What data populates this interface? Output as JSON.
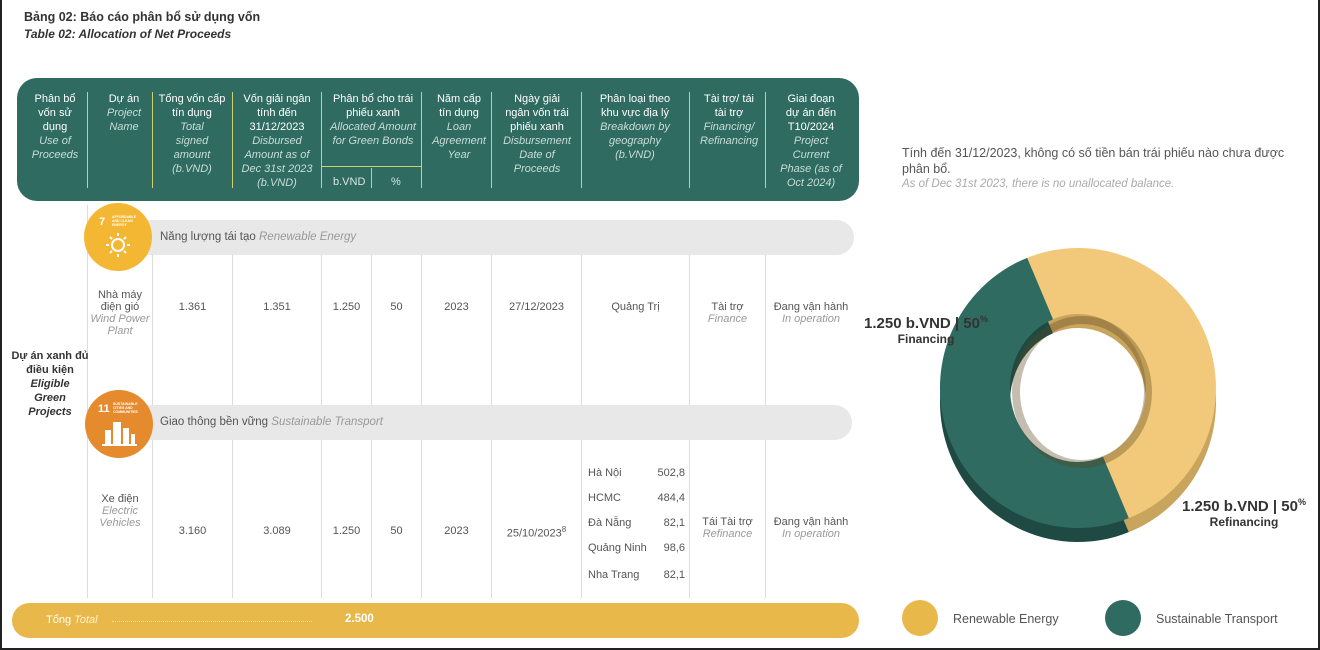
{
  "title": {
    "vi": "Bảng 02: Báo cáo phân bổ sử dụng vốn",
    "en": "Table 02: Allocation of Net Proceeds"
  },
  "header": {
    "use": {
      "vi": "Phân bổ vốn sử dụng",
      "en": "Use of Proceeds"
    },
    "project": {
      "vi": "Dự án",
      "en": "Project Name"
    },
    "total_signed": {
      "vi": "Tổng vốn cấp tín dụng",
      "en": "Total signed amount (b.VND)"
    },
    "disbursed": {
      "vi": "Vốn giải ngân tính đến 31/12/2023",
      "en": "Disbursed Amount as of Dec 31st 2023 (b.VND)"
    },
    "allocated": {
      "vi": "Phân bổ cho trái phiếu xanh",
      "en": "Allocated Amount for Green Bonds",
      "sub1": "b.VND",
      "sub2": "%"
    },
    "loan_year": {
      "vi": "Năm cấp tín dụng",
      "en": "Loan Agreement Year"
    },
    "disb_date": {
      "vi": "Ngày giải ngân vốn trái phiếu xanh",
      "en": "Disbursement Date of Proceeds"
    },
    "geography": {
      "vi": "Phân loại theo khu vực địa lý",
      "en": "Breakdown by geography (b.VND)"
    },
    "financing": {
      "vi": "Tài trợ/ tái tài trợ",
      "en": "Financing/ Refinancing"
    },
    "phase": {
      "vi": "Giai đoạn dự án đến T10/2024",
      "en": "Project Current Phase (as of Oct 2024)"
    }
  },
  "category_label": {
    "vi": "Dự án xanh đủ điều kiện",
    "en": "Eligible Green Projects"
  },
  "sections": [
    {
      "sdg_number": "7",
      "sdg_caption": "AFFORDABLE AND CLEAN ENERGY",
      "sdg_icon": "sun-icon",
      "band_vi": "Năng lượng tái tạo",
      "band_en": "Renewable Energy",
      "project_vi": "Nhà máy điện gió",
      "project_en": "Wind Power Plant",
      "total_signed": "1.361",
      "disbursed": "1.351",
      "alloc_bvnd": "1.250",
      "alloc_pct": "50",
      "year": "2023",
      "date": "27/12/2023",
      "date_note": "",
      "geography": "Quảng Trị",
      "financing_vi": "Tài trợ",
      "financing_en": "Finance",
      "phase_vi": "Đang vận hành",
      "phase_en": "In operation"
    },
    {
      "sdg_number": "11",
      "sdg_caption": "SUSTAINABLE CITIES AND COMMUNITIES",
      "sdg_icon": "city-icon",
      "band_vi": "Giao thông bền vững",
      "band_en": "Sustainable Transport",
      "project_vi": "Xe điện",
      "project_en": "Electric Vehicles",
      "total_signed": "3.160",
      "disbursed": "3.089",
      "alloc_bvnd": "1.250",
      "alloc_pct": "50",
      "year": "2023",
      "date": "25/10/2023",
      "date_note": "8",
      "geo_list": [
        {
          "name": "Hà Nội",
          "value": "502,8"
        },
        {
          "name": "HCMC",
          "value": "484,4"
        },
        {
          "name": "Đà Nẵng",
          "value": "82,1"
        },
        {
          "name": "Quảng Ninh",
          "value": "98,6"
        },
        {
          "name": "Nha Trang",
          "value": "82,1"
        }
      ],
      "financing_vi": "Tái Tài trợ",
      "financing_en": "Refinance",
      "phase_vi": "Đang vận hành",
      "phase_en": "In operation"
    }
  ],
  "total": {
    "vi": "Tổng",
    "en": "Total",
    "value": "2.500"
  },
  "note": {
    "vi": "Tính đến 31/12/2023, không có số tiền bán trái phiếu nào chưa được phân bổ.",
    "en": "As of Dec 31st 2023, there is no unallocated balance."
  },
  "chart_data": {
    "type": "pie",
    "categories": [
      "Renewable Energy",
      "Sustainable Transport"
    ],
    "values": [
      1250,
      1250
    ],
    "percent": [
      50,
      50
    ],
    "labels": [
      {
        "amount": "1.250 b.VND | 50",
        "unit": "%",
        "text": "Financing"
      },
      {
        "amount": "1.250 b.VND | 50",
        "unit": "%",
        "text": "Refinancing"
      }
    ],
    "colors": [
      "#f2c97a",
      "#2f6b61"
    ],
    "legend": [
      "Renewable Energy",
      "Sustainable Transport"
    ],
    "legend_colors": [
      "#e9b84a",
      "#2f6b61"
    ],
    "legend_position": "bottom"
  }
}
